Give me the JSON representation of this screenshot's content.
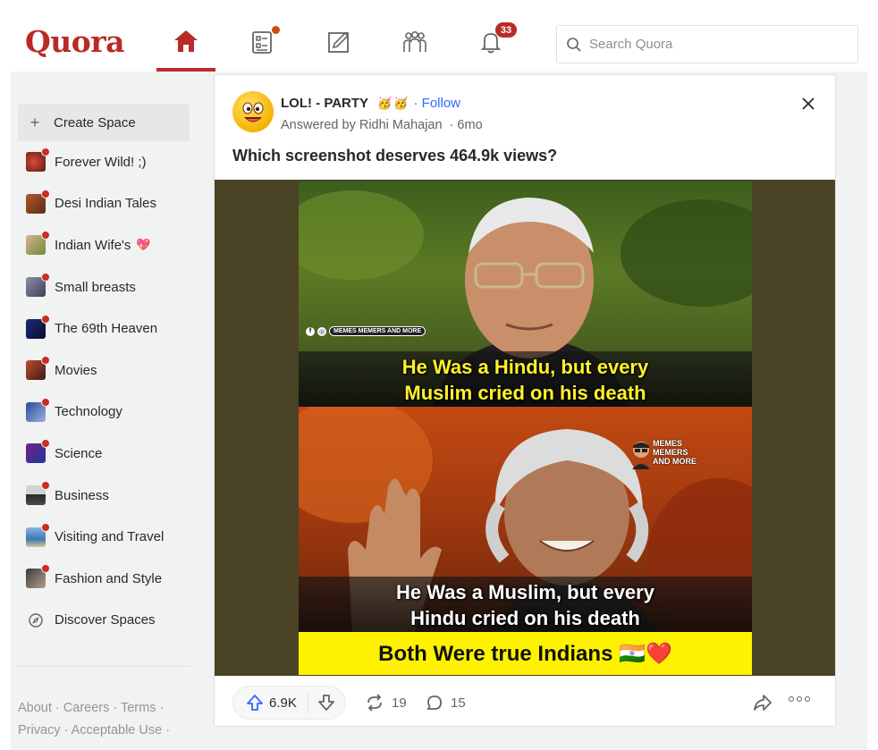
{
  "header": {
    "logo": "Quora",
    "notification_count": "33",
    "search_placeholder": "Search Quora",
    "accent_color": "#b92b27"
  },
  "sidebar": {
    "create_label": "Create Space",
    "items": [
      {
        "label": "Forever Wild! ;)",
        "icon": "space-thumb"
      },
      {
        "label": "Desi Indian Tales",
        "icon": "space-thumb"
      },
      {
        "label": "Indian Wife's",
        "icon": "space-thumb",
        "suffix": "💖"
      },
      {
        "label": "Small breasts",
        "icon": "space-thumb"
      },
      {
        "label": "The 69th Heaven",
        "icon": "space-thumb"
      },
      {
        "label": "Movies",
        "icon": "space-thumb"
      },
      {
        "label": "Technology",
        "icon": "space-thumb"
      },
      {
        "label": "Science",
        "icon": "space-thumb"
      },
      {
        "label": "Business",
        "icon": "space-thumb"
      },
      {
        "label": "Visiting and Travel",
        "icon": "space-thumb"
      },
      {
        "label": "Fashion and Style",
        "icon": "space-thumb"
      }
    ],
    "discover_label": "Discover Spaces",
    "footer_line1": "About · Careers · Terms ·",
    "footer_line2": "Privacy · Acceptable Use ·"
  },
  "post": {
    "space_name": "LOL! - PARTY",
    "space_emojis": "🥳🥳",
    "follow_label": "· Follow",
    "answered_by": "Answered by Ridhi Mahajan",
    "time": "· 6mo",
    "question": "Which screenshot deserves 464.9k views?",
    "meme": {
      "watermark": "MEMES MEMERS AND MORE",
      "logo_text": "MEMES MEMERS AND MORE",
      "caption_top_1": "He Was a Hindu, but every",
      "caption_top_2": "Muslim cried on his death",
      "caption_bottom_1": "He Was a Muslim, but every",
      "caption_bottom_2": "Hindu cried on his death",
      "banner": "Both Were true Indians 🇮🇳❤️"
    },
    "upvotes": "6.9K",
    "shares": "19",
    "comments": "15"
  }
}
